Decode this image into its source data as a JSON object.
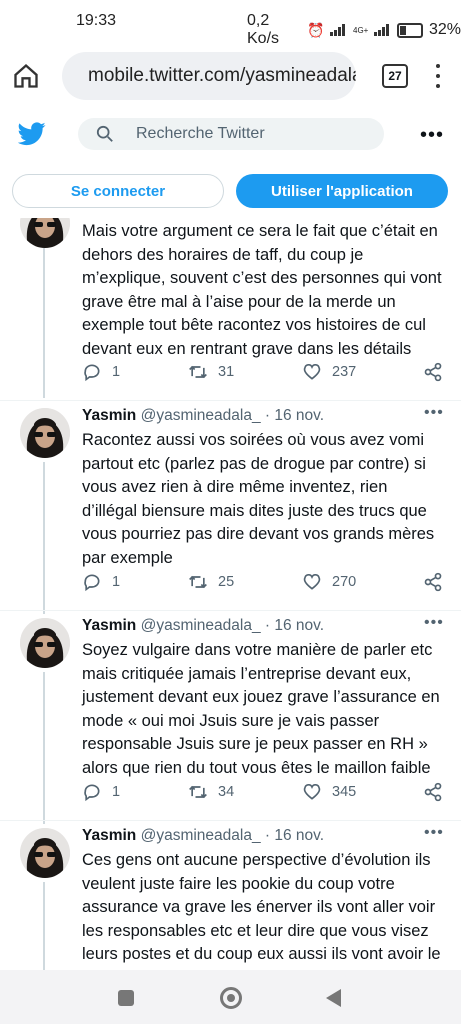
{
  "status": {
    "time": "19:33",
    "speed": "0,2 Ko/s",
    "network": "4G+",
    "battery": "32%"
  },
  "browser": {
    "url": "mobile.twitter.com/yasmineadala",
    "tab_count": "27"
  },
  "header": {
    "search_placeholder": "Recherche Twitter"
  },
  "buttons": {
    "login": "Se connecter",
    "app": "Utiliser l'application"
  },
  "tweets": [
    {
      "text": "Mais votre argument ce sera le fait que c’était en dehors des horaires de taff, du coup je m’explique, souvent c’est des personnes qui vont grave être mal à l’aise pour de la merde un exemple tout bête racontez vos histoires de cul devant eux en rentrant grave dans les détails",
      "replies": "1",
      "retweets": "31",
      "likes": "237"
    },
    {
      "name": "Yasmin",
      "handle": "@yasmineadala_",
      "date": "· 16 nov.",
      "text": "Racontez aussi vos soirées où vous avez vomi partout etc (parlez pas de drogue par contre) si vous avez rien à dire même inventez, rien d’illégal biensure mais dites juste des trucs que vous pourriez pas dire devant vos grands mères par exemple",
      "replies": "1",
      "retweets": "25",
      "likes": "270"
    },
    {
      "name": "Yasmin",
      "handle": "@yasmineadala_",
      "date": "· 16 nov.",
      "text": "Soyez vulgaire dans votre manière de parler etc mais critiquée jamais l’entreprise devant eux, justement devant eux jouez grave l’assurance en mode « oui moi Jsuis sure je vais passer responsable Jsuis sure je peux passer en RH » alors que rien du tout vous êtes le maillon faible",
      "replies": "1",
      "retweets": "34",
      "likes": "345"
    },
    {
      "name": "Yasmin",
      "handle": "@yasmineadala_",
      "date": "· 16 nov.",
      "text": "Ces gens ont aucune perspective d’évolution ils veulent juste faire les pookie du coup votre assurance va grave les énerver ils vont aller voir les responsables etc et leur dire que vous visez leurs postes et du coup eux aussi ils vont avoir le seum"
    }
  ]
}
